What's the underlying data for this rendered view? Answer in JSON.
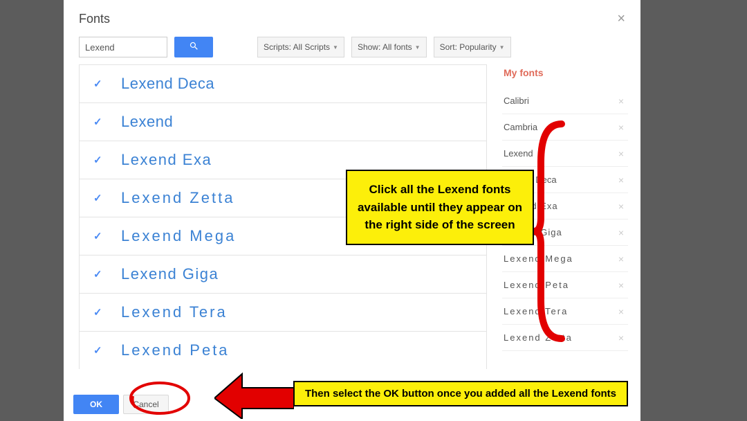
{
  "dialog": {
    "title": "Fonts",
    "close": "×"
  },
  "search": {
    "value": "Lexend"
  },
  "filters": {
    "scripts": "Scripts: All Scripts",
    "show": "Show: All fonts",
    "sort": "Sort: Popularity"
  },
  "results": [
    {
      "name": "Lexend Deca",
      "cls": ""
    },
    {
      "name": "Lexend",
      "cls": ""
    },
    {
      "name": "Lexend Exa",
      "cls": "ls-med"
    },
    {
      "name": "Lexend Zetta",
      "cls": "ls-wide fw-light"
    },
    {
      "name": "Lexend Mega",
      "cls": "ls-wide"
    },
    {
      "name": "Lexend Giga",
      "cls": "ls-med"
    },
    {
      "name": "Lexend Tera",
      "cls": "ls-wide fw-light"
    },
    {
      "name": "Lexend Peta",
      "cls": "ls-wide fw-light"
    }
  ],
  "sidebar": {
    "title": "My fonts",
    "items": [
      {
        "name": "Calibri",
        "cls": ""
      },
      {
        "name": "Cambria",
        "cls": ""
      },
      {
        "name": "Lexend",
        "cls": ""
      },
      {
        "name": "Lexend Deca",
        "cls": ""
      },
      {
        "name": "Lexend Exa",
        "cls": "ls-med"
      },
      {
        "name": "Lexend Giga",
        "cls": "ls-med"
      },
      {
        "name": "Lexend Mega",
        "cls": "ls-wide"
      },
      {
        "name": "Lexend Peta",
        "cls": "ls-wide"
      },
      {
        "name": "Lexend Tera",
        "cls": "ls-wide"
      },
      {
        "name": "Lexend Zetta",
        "cls": "ls-wide"
      }
    ]
  },
  "buttons": {
    "ok": "OK",
    "cancel": "Cancel"
  },
  "annotations": {
    "callout1": "Click all the Lexend fonts available until they appear on the right side of the screen",
    "callout2": "Then select the OK button once you added all the Lexend fonts"
  }
}
